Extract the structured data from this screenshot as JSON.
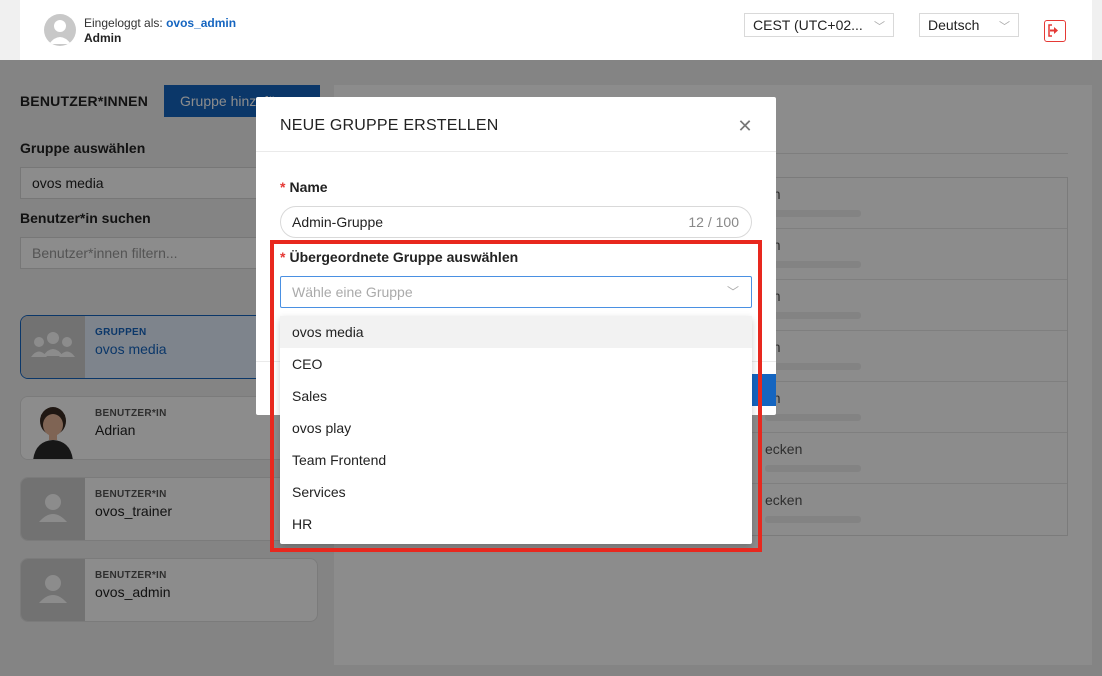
{
  "header": {
    "logged_in_prefix": "Eingeloggt als: ",
    "username": "ovos_admin",
    "role": "Admin",
    "timezone": "CEST (UTC+02...",
    "language": "Deutsch"
  },
  "page": {
    "title": "BENUTZER*INNEN",
    "add_group_label": "Gruppe hinzufügen",
    "group_select_label": "Gruppe auswählen",
    "group_select_value": "ovos media",
    "search_label": "Benutzer*in suchen",
    "search_placeholder": "Benutzer*innen filtern..."
  },
  "cards": [
    {
      "kind": "GRUPPEN",
      "name": "ovos media"
    },
    {
      "kind": "BENUTZER*IN",
      "name": "Adrian"
    },
    {
      "kind": "BENUTZER*IN",
      "name": "ovos_trainer"
    },
    {
      "kind": "BENUTZER*IN",
      "name": "ovos_admin"
    }
  ],
  "right_rows": [
    "en",
    "en",
    "en",
    "en",
    "en",
    "ecken",
    "ecken"
  ],
  "modal": {
    "title": "NEUE GRUPPE ERSTELLEN",
    "required_mark": "*",
    "name_label": "Name",
    "name_value": "Admin-Gruppe",
    "name_counter": "12 / 100",
    "parent_label": "Übergeordnete Gruppe auswählen",
    "parent_placeholder": "Wähle eine Gruppe"
  },
  "dropdown": {
    "options": [
      "ovos media",
      "CEO",
      "Sales",
      "ovos play",
      "Team Frontend",
      "Services",
      "HR"
    ],
    "highlighted_index": 0
  },
  "colors": {
    "accent": "#1565c0",
    "highlight_border": "#e8281e",
    "required": "#e53935"
  }
}
